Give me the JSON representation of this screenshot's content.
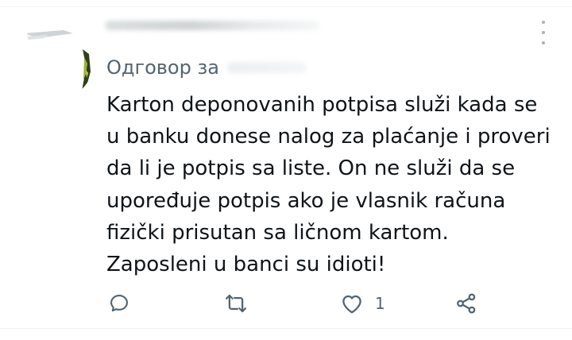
{
  "tweet": {
    "reply_to_label": "Одговор за",
    "text_lines": [
      "Karton deponovanih potpisa služi kada se",
      "u banku donese nalog za plaćanje i proveri",
      "da li je potpis sa liste. On ne služi da se",
      "upoređuje potpis ako je vlasnik računa",
      "fizički prisutan sa ličnom kartom.",
      "Zaposleni u banci su idioti!"
    ]
  },
  "actions": {
    "reply_icon": "speech-bubble",
    "retweet_icon": "retweet-arrows",
    "like_icon": "heart-outline",
    "like_count": "1",
    "share_icon": "share-nodes"
  },
  "colors": {
    "text": "#0f1419",
    "secondary": "#536471",
    "icon": "#536471",
    "divider": "#eff3f4"
  }
}
